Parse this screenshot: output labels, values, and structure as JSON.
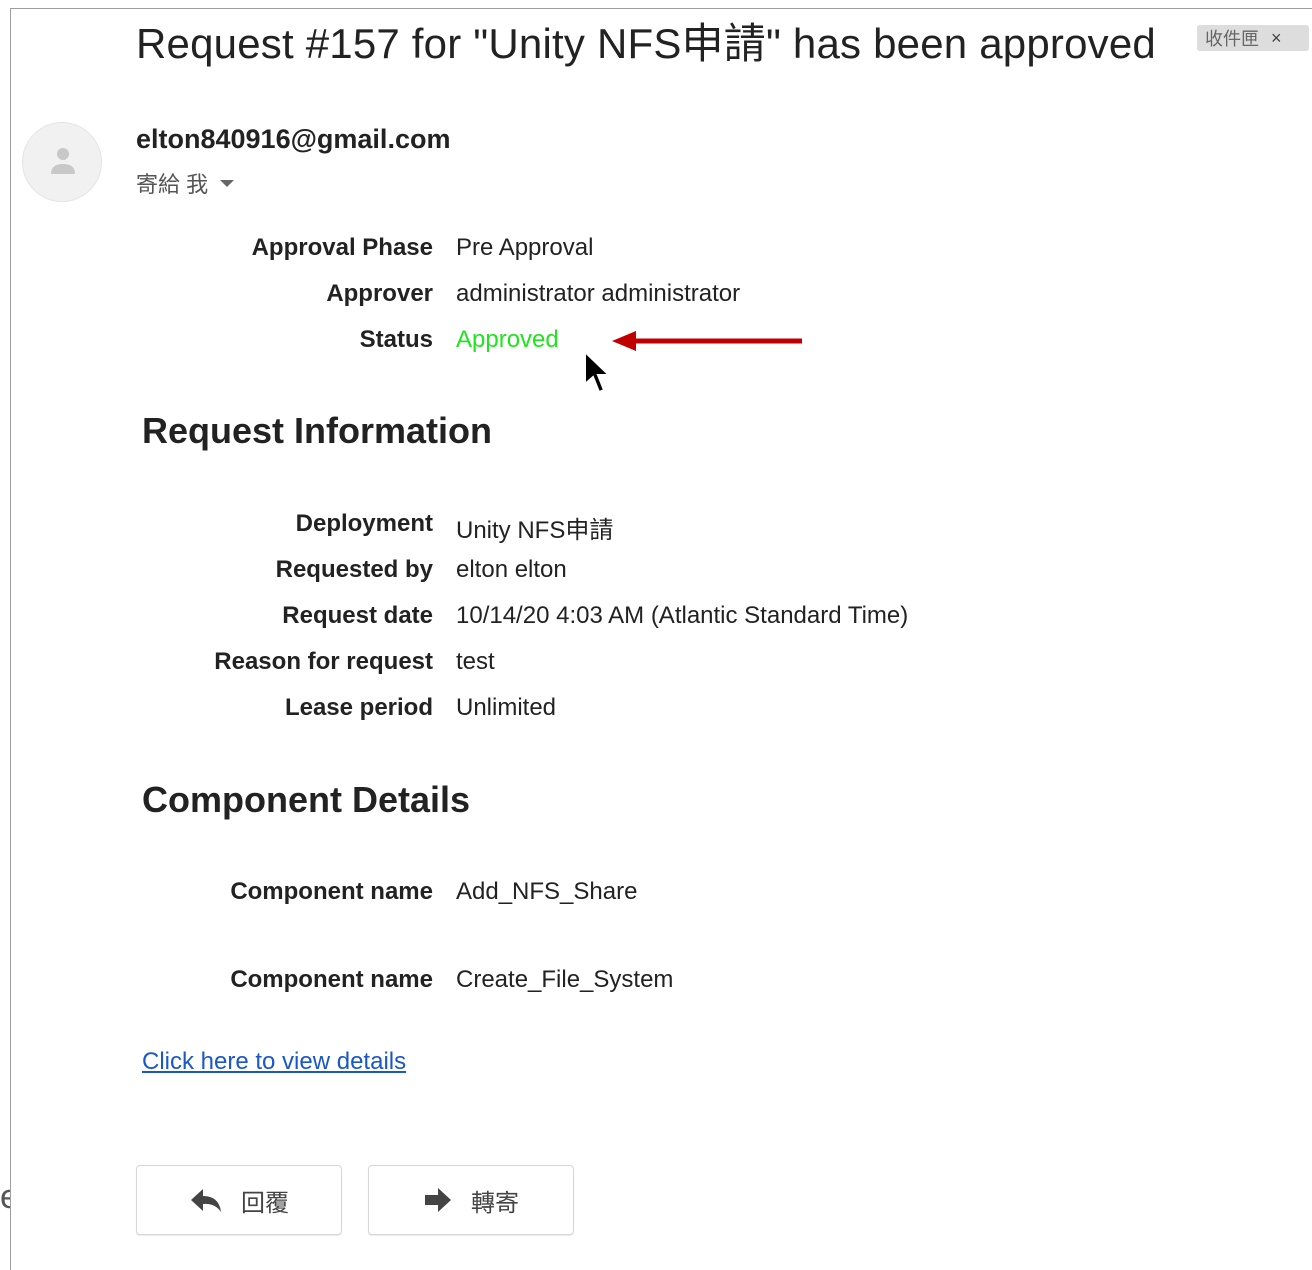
{
  "subject": "Request #157 for \"Unity NFS申請\" has been approved",
  "inbox_tag": {
    "label": "收件匣",
    "close": "×"
  },
  "sender": "elton840916@gmail.com",
  "recipient": "寄給 我",
  "approval": [
    {
      "label": "Approval Phase",
      "value": "Pre Approval"
    },
    {
      "label": "Approver",
      "value": "administrator administrator"
    },
    {
      "label": "Status",
      "value": "Approved"
    }
  ],
  "sections": {
    "request_info": "Request Information",
    "component_details": "Component Details"
  },
  "request": [
    {
      "label": "Deployment",
      "value": "Unity NFS申請"
    },
    {
      "label": "Requested by",
      "value": "elton elton"
    },
    {
      "label": "Request date",
      "value": "10/14/20 4:03 AM (Atlantic Standard Time)"
    },
    {
      "label": "Reason for request",
      "value": "test"
    },
    {
      "label": "Lease period",
      "value": "Unlimited"
    }
  ],
  "components": [
    {
      "label": "Component name",
      "value": "Add_NFS_Share"
    },
    {
      "label": "Component name",
      "value": "Create_File_System"
    }
  ],
  "details_link": "Click here to view details",
  "buttons": {
    "reply": "回覆",
    "forward": "轉寄"
  },
  "edge_text": "e",
  "colors": {
    "status_approved": "#1fe41f",
    "annotation_arrow": "#c00000",
    "link": "#1a57c7"
  }
}
